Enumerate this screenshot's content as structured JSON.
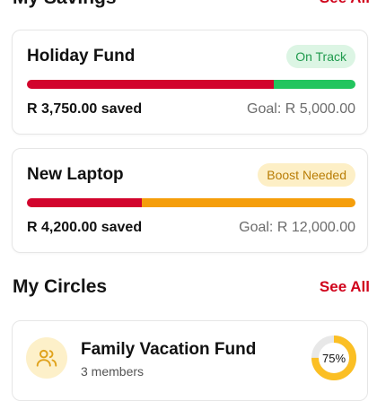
{
  "savings": {
    "title": "My Savings",
    "see_all": "See All",
    "goals": [
      {
        "name": "Holiday Fund",
        "status": "On Track",
        "saved": "R 3,750.00 saved",
        "goal": "Goal: R 5,000.00",
        "progress": 0.75,
        "status_color": "#22c55e"
      },
      {
        "name": "New Laptop",
        "status": "Boost Needed",
        "saved": "R 4,200.00 saved",
        "goal": "Goal: R 12,000.00",
        "progress": 0.35,
        "status_color": "#f59e0b"
      }
    ]
  },
  "circles": {
    "title": "My Circles",
    "see_all": "See All",
    "items": [
      {
        "name": "Family Vacation Fund",
        "members": "3 members",
        "progress_label": "75%",
        "progress": 0.75,
        "icon": "users-icon"
      }
    ]
  },
  "colors": {
    "accent": "#d2042d",
    "on_track": "#22c55e",
    "boost": "#f59e0b",
    "circle_ring": "#fbbf24",
    "track": "#e8e8e8"
  }
}
